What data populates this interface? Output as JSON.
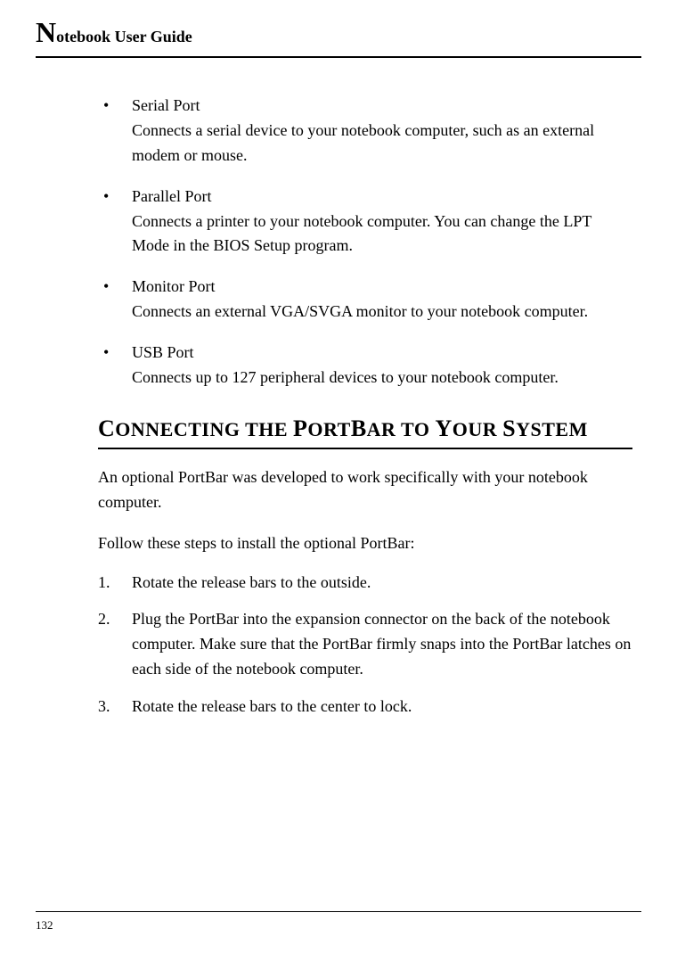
{
  "header": {
    "dropcap": "N",
    "title_rest": "otebook User Guide"
  },
  "bullets": [
    {
      "title": "Serial Port",
      "desc": "Connects a serial device to your notebook computer, such as an external modem or mouse."
    },
    {
      "title": "Parallel Port",
      "desc": "Connects a printer to your notebook computer.  You can change the LPT Mode in the BIOS Setup program."
    },
    {
      "title": "Monitor Port",
      "desc": "Connects an external VGA/SVGA monitor to your notebook computer."
    },
    {
      "title": "USB Port",
      "desc": "Connects up to 127 peripheral devices to your notebook computer."
    }
  ],
  "section_heading_parts": [
    "C",
    "ONNECTING THE ",
    "P",
    "ORT",
    "B",
    "AR TO ",
    "Y",
    "OUR ",
    "S",
    "YSTEM"
  ],
  "paragraphs": {
    "intro": "An optional PortBar was developed to work specifically with your notebook computer.",
    "follow": "Follow these steps to install the optional PortBar:"
  },
  "steps": [
    {
      "num": "1.",
      "text": "Rotate the release bars to the outside."
    },
    {
      "num": "2.",
      "text": "Plug the PortBar into the expansion connector on the back of the notebook computer. Make sure that the PortBar firmly snaps into the PortBar latches on each side of the notebook computer."
    },
    {
      "num": "3.",
      "text": "Rotate the release bars to the center to lock."
    }
  ],
  "page_number": "132"
}
